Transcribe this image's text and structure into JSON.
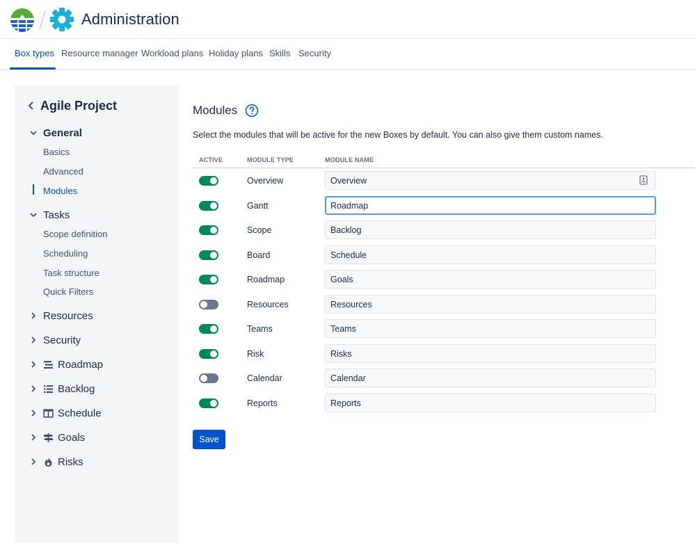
{
  "header": {
    "title": "Administration",
    "logo_icon": "bigpicture-logo-icon",
    "settings_icon": "gear-icon",
    "accent": "#1cb1d4"
  },
  "tabs": [
    {
      "label": "Box types",
      "active": true
    },
    {
      "label": "Resource manager",
      "active": false
    },
    {
      "label": "Workload plans",
      "active": false
    },
    {
      "label": "Holiday plans",
      "active": false
    },
    {
      "label": "Skills",
      "active": false
    },
    {
      "label": "Security",
      "active": false
    }
  ],
  "sidebar": {
    "title": "Agile Project",
    "groups": [
      {
        "label": "General",
        "expanded": true,
        "items": [
          "Basics",
          "Advanced",
          "Modules"
        ],
        "active_item": "Modules"
      },
      {
        "label": "Tasks",
        "expanded": true,
        "items": [
          "Scope definition",
          "Scheduling",
          "Task structure",
          "Quick Filters"
        ]
      },
      {
        "label": "Resources",
        "expanded": false
      },
      {
        "label": "Security",
        "expanded": false
      },
      {
        "label": "Roadmap",
        "expanded": false,
        "icon": "roadmap-icon"
      },
      {
        "label": "Backlog",
        "expanded": false,
        "icon": "list-icon"
      },
      {
        "label": "Schedule",
        "expanded": false,
        "icon": "schedule-icon"
      },
      {
        "label": "Goals",
        "expanded": false,
        "icon": "signpost-icon"
      },
      {
        "label": "Risks",
        "expanded": false,
        "icon": "fire-icon"
      }
    ]
  },
  "main": {
    "title": "Modules",
    "help_icon": "question-icon",
    "description": "Select the modules that will be active for the new Boxes by default. You can also give them custom names.",
    "columns": [
      "ACTIVE",
      "MODULE TYPE",
      "MODULE NAME"
    ],
    "rows": [
      {
        "type": "Overview",
        "name": "Overview",
        "active": true
      },
      {
        "type": "Gantt",
        "name": "Roadmap",
        "active": true
      },
      {
        "type": "Scope",
        "name": "Backlog",
        "active": true
      },
      {
        "type": "Board",
        "name": "Schedule",
        "active": true
      },
      {
        "type": "Roadmap",
        "name": "Goals",
        "active": true
      },
      {
        "type": "Resources",
        "name": "Resources",
        "active": false
      },
      {
        "type": "Teams",
        "name": "Teams",
        "active": true
      },
      {
        "type": "Risk",
        "name": "Risks",
        "active": true
      },
      {
        "type": "Calendar",
        "name": "Calendar",
        "active": false
      },
      {
        "type": "Reports",
        "name": "Reports",
        "active": true
      }
    ],
    "save_label": "Save"
  },
  "colors": {
    "primary": "#0052cc",
    "toggle_on": "#00875a",
    "toggle_off": "#6b778c"
  }
}
